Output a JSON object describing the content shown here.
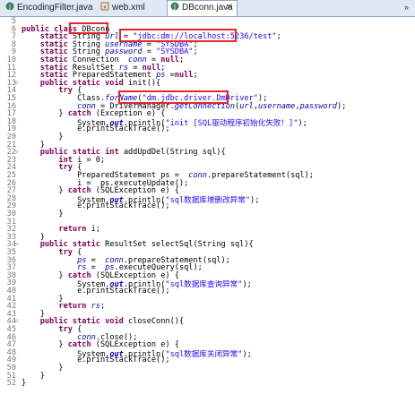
{
  "tabs": [
    {
      "label": "EncodingFilter.java",
      "icon": "java-file-icon",
      "active": false
    },
    {
      "label": "web.xml",
      "icon": "xml-file-icon",
      "active": false
    },
    {
      "label": "DBconn.java",
      "icon": "java-file-icon",
      "active": true
    }
  ],
  "close_glyph": "✕",
  "overflow_glyph": "»",
  "lines": [
    {
      "n": "5",
      "fold": "",
      "segs": [
        {
          "t": "",
          "c": ""
        }
      ]
    },
    {
      "n": "6",
      "fold": "",
      "segs": [
        {
          "t": "public class ",
          "c": "kw"
        },
        {
          "t": "DBconn",
          "c": ""
        }
      ]
    },
    {
      "n": "7",
      "fold": "",
      "segs": [
        {
          "t": "    static ",
          "c": "kw"
        },
        {
          "t": "String ",
          "c": ""
        },
        {
          "t": "url",
          "c": "var"
        },
        {
          "t": " = ",
          "c": ""
        },
        {
          "t": "\"jdbc:dm://localhost:5236/test\"",
          "c": "str"
        },
        {
          "t": ";",
          "c": ""
        }
      ]
    },
    {
      "n": "8",
      "fold": "",
      "segs": [
        {
          "t": "    static ",
          "c": "kw"
        },
        {
          "t": "String ",
          "c": ""
        },
        {
          "t": "username",
          "c": "var"
        },
        {
          "t": " = ",
          "c": ""
        },
        {
          "t": "\"SYSDBA\"",
          "c": "str"
        },
        {
          "t": ";",
          "c": ""
        }
      ]
    },
    {
      "n": "9",
      "fold": "",
      "segs": [
        {
          "t": "    static ",
          "c": "kw"
        },
        {
          "t": "String ",
          "c": ""
        },
        {
          "t": "password",
          "c": "var"
        },
        {
          "t": " = ",
          "c": ""
        },
        {
          "t": "\"SYSDBA\"",
          "c": "str"
        },
        {
          "t": ";",
          "c": ""
        }
      ]
    },
    {
      "n": "10",
      "fold": "",
      "segs": [
        {
          "t": "    static ",
          "c": "kw"
        },
        {
          "t": "Connection  ",
          "c": ""
        },
        {
          "t": "conn",
          "c": "var"
        },
        {
          "t": " = ",
          "c": ""
        },
        {
          "t": "null",
          "c": "kw"
        },
        {
          "t": ";",
          "c": ""
        }
      ]
    },
    {
      "n": "11",
      "fold": "",
      "segs": [
        {
          "t": "    static ",
          "c": "kw"
        },
        {
          "t": "ResultSet ",
          "c": ""
        },
        {
          "t": "rs",
          "c": "var"
        },
        {
          "t": " = ",
          "c": ""
        },
        {
          "t": "null",
          "c": "kw"
        },
        {
          "t": ";",
          "c": ""
        }
      ]
    },
    {
      "n": "12",
      "fold": "",
      "segs": [
        {
          "t": "    static ",
          "c": "kw"
        },
        {
          "t": "PreparedStatement ",
          "c": ""
        },
        {
          "t": "ps",
          "c": "var"
        },
        {
          "t": " =",
          "c": ""
        },
        {
          "t": "null",
          "c": "kw"
        },
        {
          "t": ";",
          "c": ""
        }
      ]
    },
    {
      "n": "13",
      "fold": "⊖",
      "segs": [
        {
          "t": "    public static void ",
          "c": "kw"
        },
        {
          "t": "init(){",
          "c": ""
        }
      ]
    },
    {
      "n": "14",
      "fold": "",
      "segs": [
        {
          "t": "        try ",
          "c": "kw"
        },
        {
          "t": "{",
          "c": ""
        }
      ]
    },
    {
      "n": "15",
      "fold": "",
      "segs": [
        {
          "t": "            Class.",
          "c": ""
        },
        {
          "t": "forName",
          "c": "var"
        },
        {
          "t": "(",
          "c": ""
        },
        {
          "t": "\"dm.jdbc.driver.DmDriver\"",
          "c": "str"
        },
        {
          "t": ");",
          "c": ""
        }
      ]
    },
    {
      "n": "16",
      "fold": "",
      "segs": [
        {
          "t": "            ",
          "c": ""
        },
        {
          "t": "conn",
          "c": "var"
        },
        {
          "t": " = DriverManager.",
          "c": ""
        },
        {
          "t": "getConnection",
          "c": "var"
        },
        {
          "t": "(",
          "c": ""
        },
        {
          "t": "url",
          "c": "var"
        },
        {
          "t": ",",
          "c": ""
        },
        {
          "t": "username",
          "c": "var"
        },
        {
          "t": ",",
          "c": ""
        },
        {
          "t": "password",
          "c": "var"
        },
        {
          "t": ");",
          "c": ""
        }
      ]
    },
    {
      "n": "17",
      "fold": "",
      "segs": [
        {
          "t": "        } ",
          "c": ""
        },
        {
          "t": "catch ",
          "c": "kw"
        },
        {
          "t": "(Exception e) {",
          "c": ""
        }
      ]
    },
    {
      "n": "18",
      "fold": "",
      "segs": [
        {
          "t": "            System.",
          "c": ""
        },
        {
          "t": "out",
          "c": "st"
        },
        {
          "t": ".println(",
          "c": ""
        },
        {
          "t": "\"init [SQL驱动程序初始化失败！]\"",
          "c": "str"
        },
        {
          "t": ");",
          "c": ""
        }
      ]
    },
    {
      "n": "19",
      "fold": "",
      "segs": [
        {
          "t": "            e.printStackTrace();",
          "c": ""
        }
      ]
    },
    {
      "n": "20",
      "fold": "",
      "segs": [
        {
          "t": "        }",
          "c": ""
        }
      ]
    },
    {
      "n": "21",
      "fold": "",
      "segs": [
        {
          "t": "    }",
          "c": ""
        }
      ]
    },
    {
      "n": "22",
      "fold": "⊖",
      "segs": [
        {
          "t": "    public static int ",
          "c": "kw"
        },
        {
          "t": "addUpdDel(String sql){",
          "c": ""
        }
      ]
    },
    {
      "n": "23",
      "fold": "",
      "segs": [
        {
          "t": "        int ",
          "c": "kw"
        },
        {
          "t": "i = 0;",
          "c": ""
        }
      ]
    },
    {
      "n": "24",
      "fold": "",
      "segs": [
        {
          "t": "        try ",
          "c": "kw"
        },
        {
          "t": "{",
          "c": ""
        }
      ]
    },
    {
      "n": "25",
      "fold": "",
      "segs": [
        {
          "t": "            PreparedStatement ps =  ",
          "c": ""
        },
        {
          "t": "conn",
          "c": "var"
        },
        {
          "t": ".prepareStatement(sql);",
          "c": ""
        }
      ]
    },
    {
      "n": "26",
      "fold": "",
      "segs": [
        {
          "t": "            i =  ps.executeUpdate();",
          "c": ""
        }
      ]
    },
    {
      "n": "27",
      "fold": "",
      "segs": [
        {
          "t": "        } ",
          "c": ""
        },
        {
          "t": "catch ",
          "c": "kw"
        },
        {
          "t": "(SQLException e) {",
          "c": ""
        }
      ]
    },
    {
      "n": "28",
      "fold": "",
      "segs": [
        {
          "t": "            System.",
          "c": ""
        },
        {
          "t": "out",
          "c": "st"
        },
        {
          "t": ".println(",
          "c": ""
        },
        {
          "t": "\"sql数据库增删改异常\"",
          "c": "str"
        },
        {
          "t": ");",
          "c": ""
        }
      ]
    },
    {
      "n": "29",
      "fold": "",
      "segs": [
        {
          "t": "            e.printStackTrace();",
          "c": ""
        }
      ]
    },
    {
      "n": "30",
      "fold": "",
      "segs": [
        {
          "t": "        }",
          "c": ""
        }
      ]
    },
    {
      "n": "31",
      "fold": "",
      "segs": [
        {
          "t": "",
          "c": ""
        }
      ]
    },
    {
      "n": "32",
      "fold": "",
      "segs": [
        {
          "t": "        return ",
          "c": "kw"
        },
        {
          "t": "i;",
          "c": ""
        }
      ]
    },
    {
      "n": "33",
      "fold": "",
      "segs": [
        {
          "t": "    }",
          "c": ""
        }
      ]
    },
    {
      "n": "34",
      "fold": "⊖",
      "segs": [
        {
          "t": "    public static ",
          "c": "kw"
        },
        {
          "t": "ResultSet selectSql(String sql){",
          "c": ""
        }
      ]
    },
    {
      "n": "35",
      "fold": "",
      "segs": [
        {
          "t": "        try ",
          "c": "kw"
        },
        {
          "t": "{",
          "c": ""
        }
      ]
    },
    {
      "n": "36",
      "fold": "",
      "segs": [
        {
          "t": "            ",
          "c": ""
        },
        {
          "t": "ps",
          "c": "var"
        },
        {
          "t": " =  ",
          "c": ""
        },
        {
          "t": "conn",
          "c": "var"
        },
        {
          "t": ".prepareStatement(sql);",
          "c": ""
        }
      ]
    },
    {
      "n": "37",
      "fold": "",
      "segs": [
        {
          "t": "            ",
          "c": ""
        },
        {
          "t": "rs",
          "c": "var"
        },
        {
          "t": " =  ",
          "c": ""
        },
        {
          "t": "ps",
          "c": "var"
        },
        {
          "t": ".executeQuery(sql);",
          "c": ""
        }
      ]
    },
    {
      "n": "38",
      "fold": "",
      "segs": [
        {
          "t": "        } ",
          "c": ""
        },
        {
          "t": "catch ",
          "c": "kw"
        },
        {
          "t": "(SQLException e) {",
          "c": ""
        }
      ]
    },
    {
      "n": "39",
      "fold": "",
      "segs": [
        {
          "t": "            System.",
          "c": ""
        },
        {
          "t": "out",
          "c": "st"
        },
        {
          "t": ".println(",
          "c": ""
        },
        {
          "t": "\"sql数据库查询异常\"",
          "c": "str"
        },
        {
          "t": ");",
          "c": ""
        }
      ]
    },
    {
      "n": "40",
      "fold": "",
      "segs": [
        {
          "t": "            e.printStackTrace();",
          "c": ""
        }
      ]
    },
    {
      "n": "41",
      "fold": "",
      "segs": [
        {
          "t": "        }",
          "c": ""
        }
      ]
    },
    {
      "n": "42",
      "fold": "",
      "segs": [
        {
          "t": "        return ",
          "c": "kw"
        },
        {
          "t": "rs",
          "c": "var"
        },
        {
          "t": ";",
          "c": ""
        }
      ]
    },
    {
      "n": "43",
      "fold": "",
      "segs": [
        {
          "t": "    }",
          "c": ""
        }
      ]
    },
    {
      "n": "44",
      "fold": "⊖",
      "segs": [
        {
          "t": "    public static void ",
          "c": "kw"
        },
        {
          "t": "closeConn(){",
          "c": ""
        }
      ]
    },
    {
      "n": "45",
      "fold": "",
      "segs": [
        {
          "t": "        try ",
          "c": "kw"
        },
        {
          "t": "{",
          "c": ""
        }
      ]
    },
    {
      "n": "46",
      "fold": "",
      "segs": [
        {
          "t": "            ",
          "c": ""
        },
        {
          "t": "conn",
          "c": "var"
        },
        {
          "t": ".close();",
          "c": ""
        }
      ]
    },
    {
      "n": "47",
      "fold": "",
      "segs": [
        {
          "t": "        } ",
          "c": ""
        },
        {
          "t": "catch ",
          "c": "kw"
        },
        {
          "t": "(SQLException e) {",
          "c": ""
        }
      ]
    },
    {
      "n": "48",
      "fold": "",
      "segs": [
        {
          "t": "            System.",
          "c": ""
        },
        {
          "t": "out",
          "c": "st"
        },
        {
          "t": ".println(",
          "c": ""
        },
        {
          "t": "\"sql数据库关闭异常\"",
          "c": "str"
        },
        {
          "t": ");",
          "c": ""
        }
      ]
    },
    {
      "n": "49",
      "fold": "",
      "segs": [
        {
          "t": "            e.printStackTrace();",
          "c": ""
        }
      ]
    },
    {
      "n": "50",
      "fold": "",
      "segs": [
        {
          "t": "        }",
          "c": ""
        }
      ]
    },
    {
      "n": "51",
      "fold": "",
      "segs": [
        {
          "t": "    }",
          "c": ""
        }
      ]
    },
    {
      "n": "52",
      "fold": "",
      "segs": [
        {
          "t": "}",
          "c": ""
        }
      ]
    }
  ],
  "colors": {
    "highlight_box": "#e3262b",
    "keyword": "#7f0055",
    "string": "#2a00ff",
    "field": "#0000c0"
  }
}
